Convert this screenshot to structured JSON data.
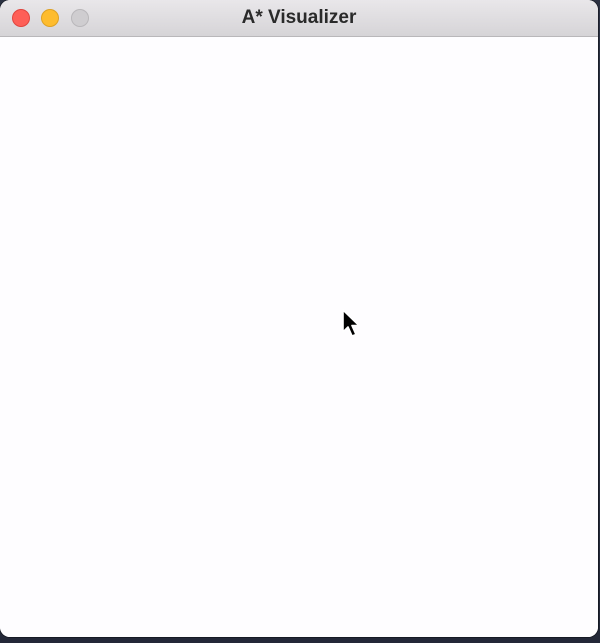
{
  "window": {
    "title": "A* Visualizer"
  },
  "colors": {
    "close": "#fe5f57",
    "minimize": "#febc2e",
    "zoom_inactive": "#cfcdd0",
    "canvas_bg": "#fefdff"
  },
  "icons": {
    "cursor": "arrow-cursor-icon"
  }
}
